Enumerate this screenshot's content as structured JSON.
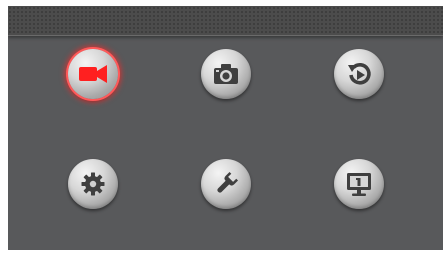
{
  "colors": {
    "panel_background": "#58595b",
    "header_texture": "#4c4c4c",
    "icon_default": "#3f3f3f",
    "icon_active": "#ff2020",
    "active_glow": "#ff5a5a"
  },
  "menu": {
    "selected": "video-record",
    "buttons": [
      {
        "id": "video-record",
        "icon": "video-camera-icon",
        "active": true
      },
      {
        "id": "photo-capture",
        "icon": "camera-icon",
        "active": false
      },
      {
        "id": "playback",
        "icon": "playback-icon",
        "active": false
      },
      {
        "id": "settings",
        "icon": "gear-icon",
        "active": false
      },
      {
        "id": "tools",
        "icon": "wrench-icon",
        "active": false
      },
      {
        "id": "display",
        "icon": "monitor-icon",
        "active": false
      }
    ]
  }
}
